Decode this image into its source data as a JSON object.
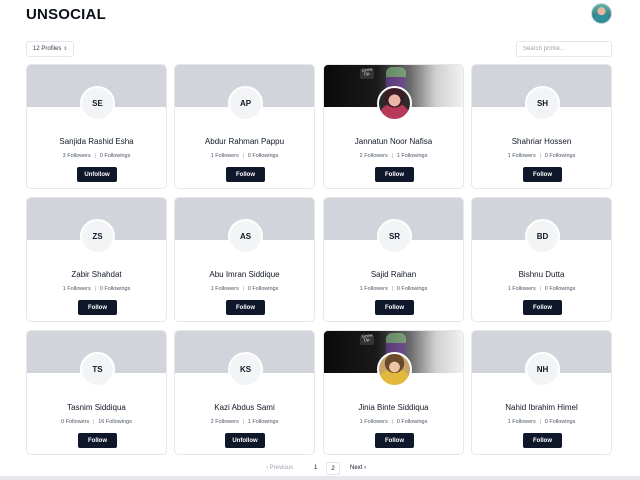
{
  "app": {
    "title": "UNSOCIAL"
  },
  "toolbar": {
    "profile_count": "12 Profiles",
    "caret": "⇕",
    "search_placeholder": "Search profile..."
  },
  "profiles": [
    {
      "initials": "SE",
      "name": "Sanjida Rashid Esha",
      "followers": "3 Followers",
      "followings": "0 Followings",
      "action": "Unfollow"
    },
    {
      "initials": "AP",
      "name": "Abdur Rahman Pappu",
      "followers": "1 Followers",
      "followings": "0 Followings",
      "action": "Follow"
    },
    {
      "initials": "",
      "name": "Jannatun Noor Nafisa",
      "followers": "2 Followers",
      "followings": "1 Followings",
      "action": "Follow"
    },
    {
      "initials": "SH",
      "name": "Shahriar Hossen",
      "followers": "1 Followers",
      "followings": "0 Followings",
      "action": "Follow"
    },
    {
      "initials": "ZS",
      "name": "Zabir Shahdat",
      "followers": "1 Followers",
      "followings": "0 Followings",
      "action": "Follow"
    },
    {
      "initials": "AS",
      "name": "Abu Imran Siddique",
      "followers": "1 Followers",
      "followings": "0 Followings",
      "action": "Follow"
    },
    {
      "initials": "SR",
      "name": "Sajid Raihan",
      "followers": "1 Followers",
      "followings": "0 Followings",
      "action": "Follow"
    },
    {
      "initials": "BD",
      "name": "Bishnu Dutta",
      "followers": "1 Followers",
      "followings": "0 Followings",
      "action": "Follow"
    },
    {
      "initials": "TS",
      "name": "Tasnim Siddiqua",
      "followers": "0 Followers",
      "followings": "16 Followings",
      "action": "Follow"
    },
    {
      "initials": "KS",
      "name": "Kazi Abdus Sami",
      "followers": "2 Followers",
      "followings": "1 Followings",
      "action": "Unfollow"
    },
    {
      "initials": "",
      "name": "Jinia Binte Siddiqua",
      "followers": "1 Followers",
      "followings": "0 Followings",
      "action": "Follow"
    },
    {
      "initials": "NH",
      "name": "Nahid Ibrahim Himel",
      "followers": "1 Followers",
      "followings": "0 Followings",
      "action": "Follow"
    }
  ],
  "pagination": {
    "prev": "‹ Previous",
    "page1": "1",
    "page2": "2",
    "next": "Next ›"
  },
  "colors": {
    "button_bg": "#0f172a",
    "cover_bg": "#d1d5db",
    "avatar_bg": "#f3f4f6"
  }
}
